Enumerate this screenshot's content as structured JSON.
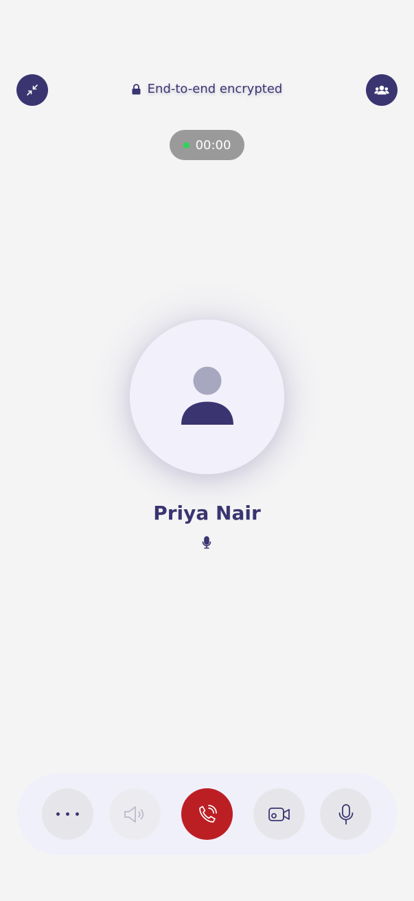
{
  "header": {
    "encryption_label": "End-to-end encrypted",
    "minimize_icon": "minimize-arrows-icon",
    "participants_icon": "group-icon"
  },
  "call": {
    "timer": "00:00",
    "contact_name": "Priya Nair",
    "status_icon": "microphone-icon"
  },
  "controls": [
    {
      "name": "more",
      "icon": "more-dots-icon",
      "enabled": true
    },
    {
      "name": "speaker",
      "icon": "speaker-icon",
      "enabled": false
    },
    {
      "name": "end-call",
      "icon": "phone-hangup-icon",
      "enabled": true
    },
    {
      "name": "video",
      "icon": "video-camera-icon",
      "enabled": true
    },
    {
      "name": "mic",
      "icon": "microphone-icon",
      "enabled": true
    }
  ],
  "colors": {
    "brand": "#3a3570",
    "end_call": "#bb1f24",
    "timer_dot": "#2fd35a",
    "background": "#f4f4f5"
  }
}
